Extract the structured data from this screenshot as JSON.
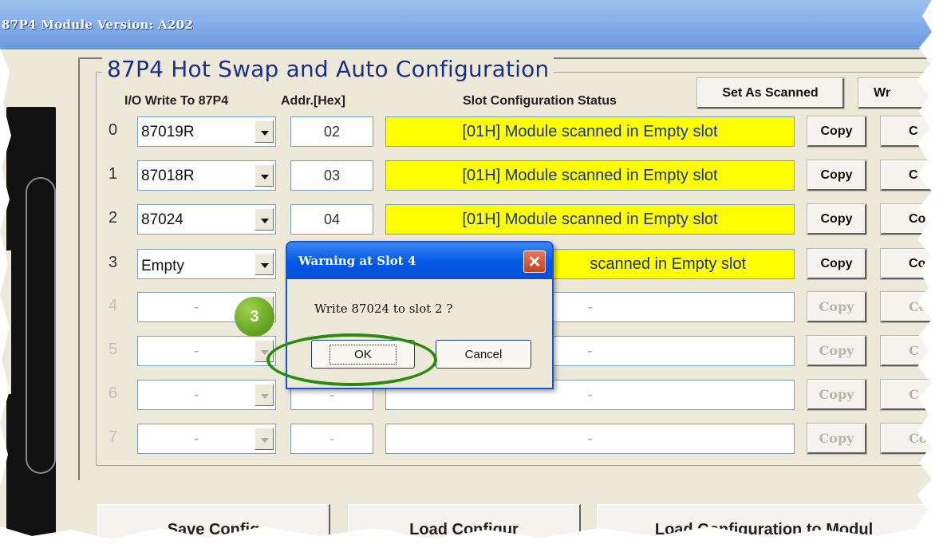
{
  "window": {
    "title": "87P4 Module Version: A202"
  },
  "group": {
    "title": "87P4 Hot Swap and Auto Configuration"
  },
  "headers": {
    "io_write": "I/O Write To 87P4",
    "addr": "Addr.[Hex]",
    "status": "Slot Configuration Status"
  },
  "toolbar": {
    "set_as_scanned": "Set As Scanned",
    "write_all": "Wr"
  },
  "rows": [
    {
      "index": "0",
      "module": "87019R",
      "addr": "02",
      "status": "[01H] Module scanned in Empty slot",
      "copy": "Copy",
      "copy2": "C",
      "enabled": true
    },
    {
      "index": "1",
      "module": "87018R",
      "addr": "03",
      "status": "[01H] Module scanned in Empty slot",
      "copy": "Copy",
      "copy2": "Co",
      "enabled": true
    },
    {
      "index": "2",
      "module": "87024",
      "addr": "04",
      "status": "[01H] Module scanned in Empty slot",
      "copy": "Copy",
      "copy2": "Co",
      "enabled": true
    },
    {
      "index": "3",
      "module": "Empty",
      "addr": "",
      "status": "scanned in Empty slot",
      "copy": "Copy",
      "copy2": "Co",
      "enabled": true
    },
    {
      "index": "4",
      "module": "-",
      "addr": "",
      "status": "-",
      "copy": "Copy",
      "copy2": "Co",
      "enabled": false
    },
    {
      "index": "5",
      "module": "-",
      "addr": "",
      "status": "-",
      "copy": "Copy",
      "copy2": "C",
      "enabled": false
    },
    {
      "index": "6",
      "module": "-",
      "addr": "-",
      "status": "-",
      "copy": "Copy",
      "copy2": "C",
      "enabled": false
    },
    {
      "index": "7",
      "module": "-",
      "addr": "-",
      "status": "-",
      "copy": "Copy",
      "copy2": "Co",
      "enabled": false
    }
  ],
  "bottom": {
    "b1": "Save Config",
    "b2": "Load Configur",
    "b3": "Load Configuration to Modul"
  },
  "dialog": {
    "title": "Warning at Slot 4",
    "message": "Write 87024 to slot 2 ?",
    "ok": "OK",
    "cancel": "Cancel",
    "close_icon": "close-icon"
  },
  "badge": {
    "step": "3"
  },
  "colors": {
    "status_yellow": "#ffff00",
    "title_blue": "#1a2f8a",
    "ring_green": "#2b8a12",
    "badge_green": "#6aa82a"
  }
}
